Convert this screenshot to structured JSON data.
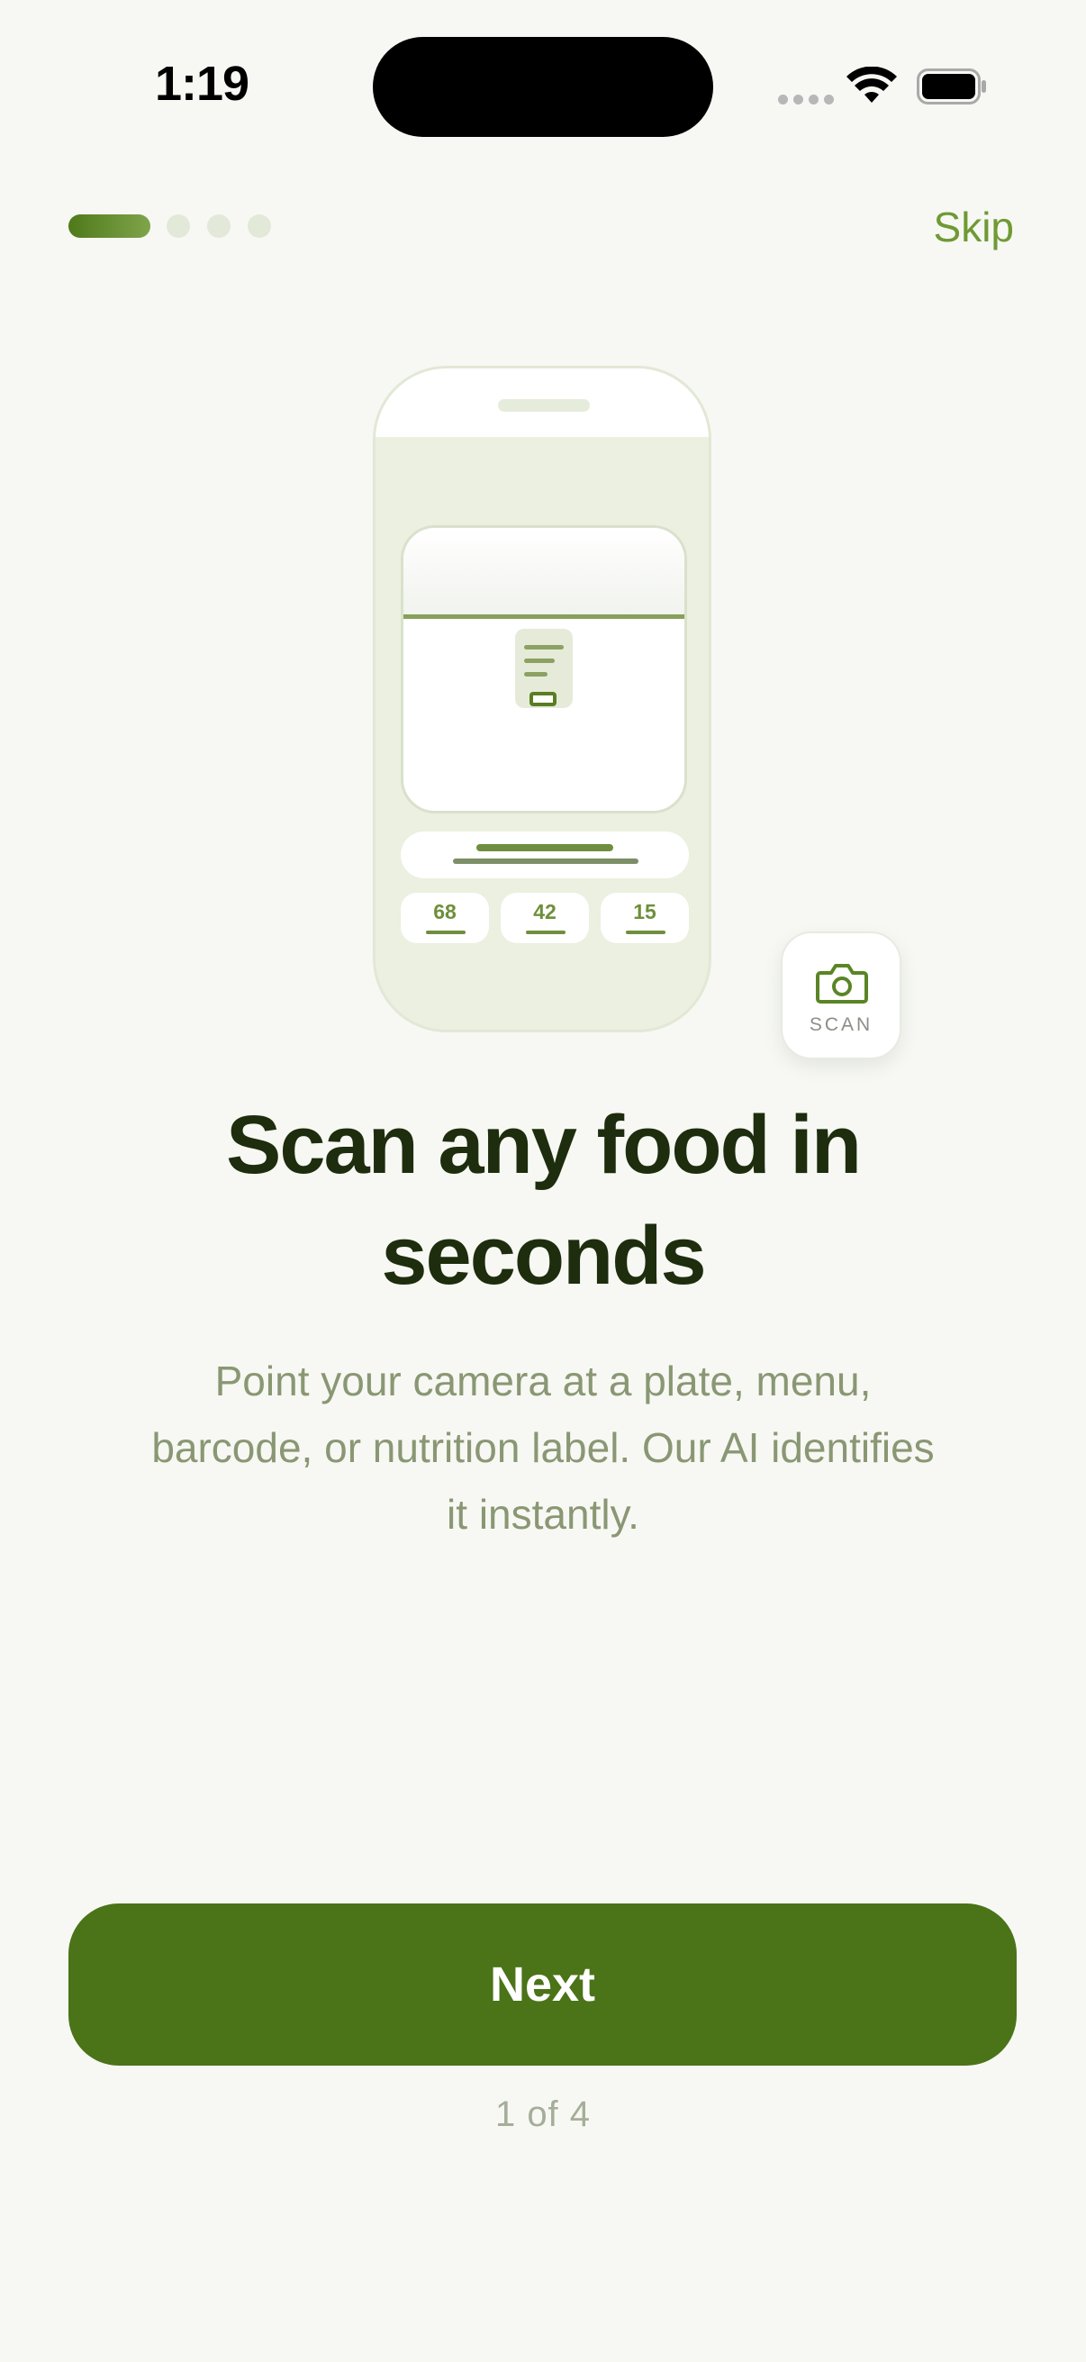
{
  "status_bar": {
    "time": "1:19"
  },
  "onboarding": {
    "skip_label": "Skip",
    "current_step": 1,
    "total_steps": 4,
    "headline_line1": "Scan any food in",
    "headline_line2": "seconds",
    "description": "Point your camera at a plate, menu, barcode, or nutrition label. Our AI identifies it instantly.",
    "next_label": "Next",
    "page_counter": "1 of 4"
  },
  "illustration": {
    "macros": [
      "68",
      "42",
      "15"
    ],
    "scan_badge_label": "SCAN"
  },
  "icons": {
    "wifi": "wifi-icon",
    "battery": "battery-icon",
    "camera": "camera-icon",
    "document": "document-icon"
  },
  "colors": {
    "accent": "#4b7318",
    "accent_light": "#6f9a34",
    "background": "#f7f8f3",
    "headline": "#1d2d0d",
    "body": "#8a9774"
  }
}
